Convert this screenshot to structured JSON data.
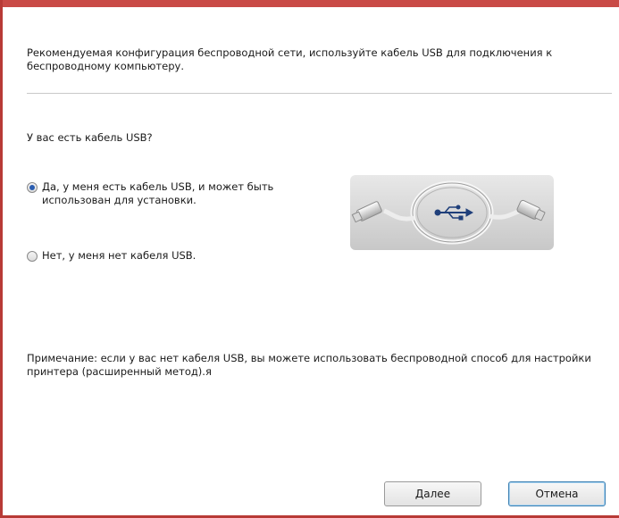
{
  "dialog": {
    "intro_text": "Рекомендуемая конфигурация беспроводной сети, используйте кабель USB для подключения к беспроводному компьютеру.",
    "question": "У вас есть кабель USB?",
    "options": [
      {
        "label": "Да, у меня есть кабель USB, и может быть использован для установки.",
        "selected": true
      },
      {
        "label": "Нет, у меня нет кабеля USB.",
        "selected": false
      }
    ],
    "image_icon": "usb-cable-icon",
    "note_text": "Примечание: если у вас нет кабеля USB, вы можете использовать беспроводной способ для настройки принтера (расширенный метод).я",
    "buttons": {
      "next_label": "Далее",
      "cancel_label": "Отмена"
    }
  },
  "colors": {
    "window_border": "#b83a36",
    "radio_selected": "#2a5db0",
    "usb_symbol": "#1f3f7a",
    "default_button_border": "#3c7fb1"
  }
}
